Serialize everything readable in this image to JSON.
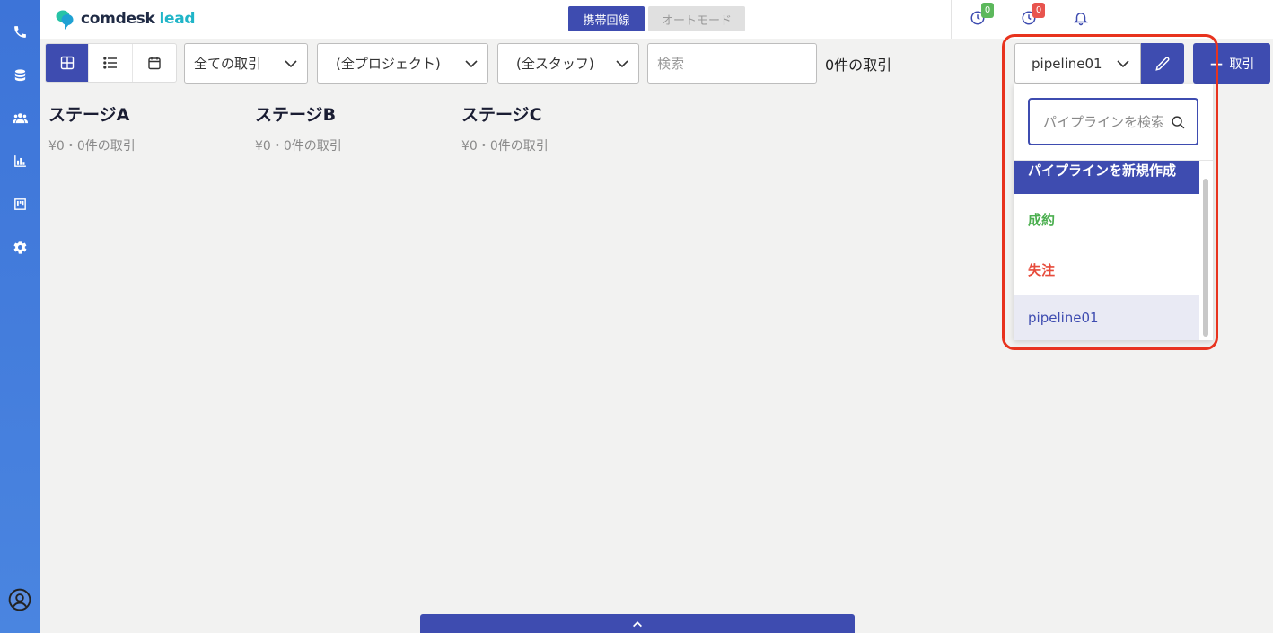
{
  "sidebar": {
    "items": [
      "phone-icon",
      "database-icon",
      "users-icon",
      "chart-icon",
      "board-icon",
      "gear-icon"
    ],
    "bottom_icon": "user-circle-icon"
  },
  "header": {
    "logo_text": "comdesk",
    "logo_accent": "lead",
    "mode_active": "携帯回線",
    "mode_inactive": "オートモード",
    "badge_green": "0",
    "badge_red": "0"
  },
  "toolbar": {
    "deal_filter": "全ての取引",
    "project_filter": "(全プロジェクト)",
    "staff_filter": "(全スタッフ)",
    "search_placeholder": "検索",
    "deal_count": "0件の取引",
    "pipeline_selected": "pipeline01",
    "add_label": "取引"
  },
  "dropdown": {
    "search_placeholder": "パイプラインを検索",
    "create_label": "パイプラインを新規作成",
    "won_label": "成約",
    "lost_label": "失注",
    "pipeline_label": "pipeline01"
  },
  "stages": [
    {
      "title": "ステージA",
      "summary": "¥0・0件の取引"
    },
    {
      "title": "ステージB",
      "summary": "¥0・0件の取引"
    },
    {
      "title": "ステージC",
      "summary": "¥0・0件の取引"
    }
  ],
  "colors": {
    "primary": "#3e4cb0",
    "sidebar": "#4a85e0",
    "won": "#4caf50",
    "lost": "#e74c3c",
    "highlight": "#e8331e"
  }
}
